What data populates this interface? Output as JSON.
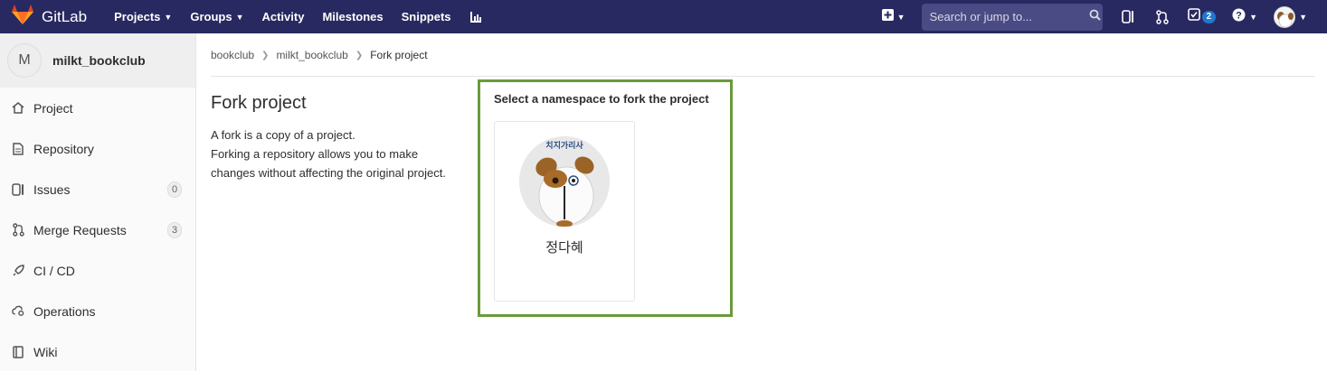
{
  "navbar": {
    "brand": "GitLab",
    "links": [
      {
        "label": "Projects",
        "dropdown": true
      },
      {
        "label": "Groups",
        "dropdown": true
      },
      {
        "label": "Activity",
        "dropdown": false
      },
      {
        "label": "Milestones",
        "dropdown": false
      },
      {
        "label": "Snippets",
        "dropdown": false
      }
    ],
    "search_placeholder": "Search or jump to...",
    "todo_count": "2",
    "bg_color": "#292961"
  },
  "sidebar": {
    "avatar_letter": "M",
    "project_name": "milkt_bookclub",
    "items": [
      {
        "label": "Project",
        "icon": "home-icon"
      },
      {
        "label": "Repository",
        "icon": "doc-icon"
      },
      {
        "label": "Issues",
        "icon": "issues-icon",
        "count": "0"
      },
      {
        "label": "Merge Requests",
        "icon": "merge-request-icon",
        "count": "3"
      },
      {
        "label": "CI / CD",
        "icon": "rocket-icon"
      },
      {
        "label": "Operations",
        "icon": "cloud-gear-icon"
      },
      {
        "label": "Wiki",
        "icon": "book-icon"
      }
    ]
  },
  "breadcrumb": [
    "bookclub",
    "milkt_bookclub",
    "Fork project"
  ],
  "page": {
    "title": "Fork project",
    "desc_line1": "A fork is a copy of a project.",
    "desc_line2": "Forking a repository allows you to make changes without affecting the original project."
  },
  "namespace": {
    "heading": "Select a namespace to fork the project",
    "card_name": "정다혜",
    "avatar_caption": "치지가리사",
    "highlight_color": "#6a9a3a"
  }
}
